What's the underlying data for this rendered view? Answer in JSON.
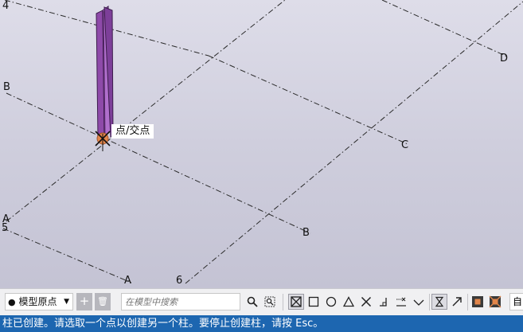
{
  "viewport": {
    "grid_labels": {
      "four": "4",
      "b_left": "B",
      "a_left": "A",
      "five": "5",
      "a_bottom": "A",
      "six": "6",
      "b_mid": "B",
      "c_right": "C",
      "d_right": "D"
    },
    "snap_tooltip": "点/交点"
  },
  "toolbar": {
    "origin_dropdown": "模型原点",
    "add_button": "+",
    "delete_button": "🗑",
    "search_placeholder": "在模型中搜索",
    "cut_label": "自"
  },
  "status_bar": {
    "message": "柱已创建。请选取一个点以创建另一个柱。要停止创建柱，请按 Esc。"
  },
  "colors": {
    "status_bg": "#1d66b0",
    "column_fill": "#9b59b6",
    "snap_marker": "#e2854a"
  }
}
